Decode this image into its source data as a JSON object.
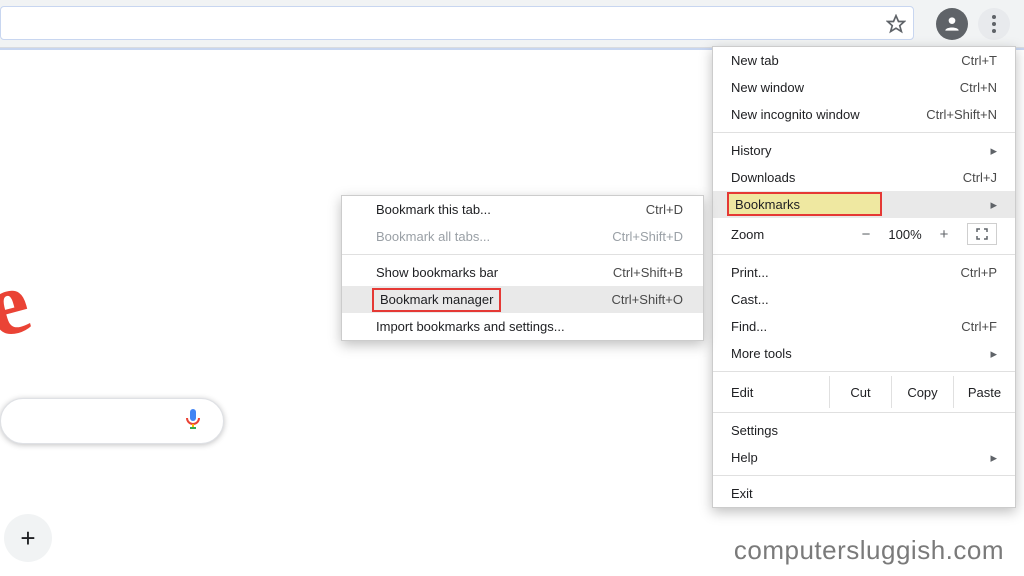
{
  "toolbar": {
    "star_tooltip": "Bookmark this tab",
    "profile_tooltip": "You",
    "menu_tooltip": "Customize and control Google Chrome"
  },
  "main_menu": {
    "new_tab": {
      "label": "New tab",
      "shortcut": "Ctrl+T"
    },
    "new_window": {
      "label": "New window",
      "shortcut": "Ctrl+N"
    },
    "incognito": {
      "label": "New incognito window",
      "shortcut": "Ctrl+Shift+N"
    },
    "history": {
      "label": "History"
    },
    "downloads": {
      "label": "Downloads",
      "shortcut": "Ctrl+J"
    },
    "bookmarks": {
      "label": "Bookmarks"
    },
    "zoom": {
      "label": "Zoom",
      "minus": "−",
      "pct": "100%",
      "plus": "+"
    },
    "print": {
      "label": "Print...",
      "shortcut": "Ctrl+P"
    },
    "cast": {
      "label": "Cast..."
    },
    "find": {
      "label": "Find...",
      "shortcut": "Ctrl+F"
    },
    "more_tools": {
      "label": "More tools"
    },
    "edit": {
      "label": "Edit",
      "cut": "Cut",
      "copy": "Copy",
      "paste": "Paste"
    },
    "settings": {
      "label": "Settings"
    },
    "help": {
      "label": "Help"
    },
    "exit": {
      "label": "Exit"
    }
  },
  "bookmarks_submenu": {
    "bookmark_tab": {
      "label": "Bookmark this tab...",
      "shortcut": "Ctrl+D"
    },
    "bookmark_all": {
      "label": "Bookmark all tabs...",
      "shortcut": "Ctrl+Shift+D"
    },
    "show_bar": {
      "label": "Show bookmarks bar",
      "shortcut": "Ctrl+Shift+B"
    },
    "manager": {
      "label": "Bookmark manager",
      "shortcut": "Ctrl+Shift+O"
    },
    "import": {
      "label": "Import bookmarks and settings..."
    }
  },
  "plus_fab": "+",
  "watermark": "computersluggish.com"
}
